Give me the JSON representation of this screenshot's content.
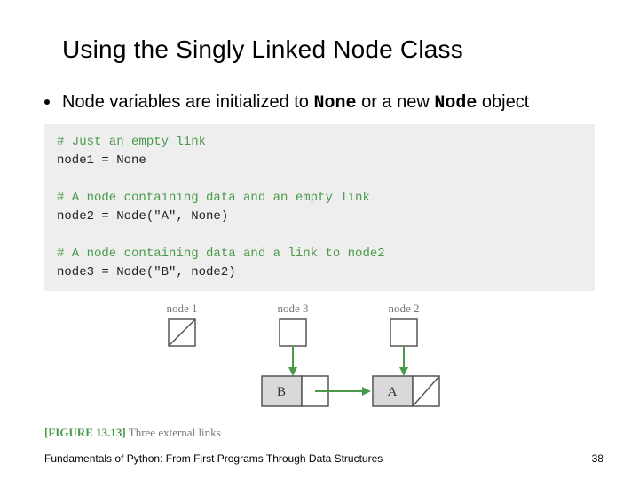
{
  "title": "Using the Singly Linked Node Class",
  "bullet": {
    "pre": "Node variables are initialized to ",
    "code1": "None",
    "mid": " or a new ",
    "code2": "Node",
    "post": " object"
  },
  "code": {
    "c1": "# Just an empty link",
    "s1": "node1 = None",
    "c2": "# A node containing data and an empty link",
    "s2": "node2 = Node(\"A\", None)",
    "c3": "# A node containing data and a link to node2",
    "s3": "node3 = Node(\"B\", node2)"
  },
  "diagram": {
    "labels": {
      "n1": "node 1",
      "n3": "node 3",
      "n2": "node 2"
    },
    "data": {
      "b": "B",
      "a": "A"
    }
  },
  "caption": {
    "lb": "[",
    "tag": "FIGURE 13.13",
    "rb": "]",
    "text": " Three external links"
  },
  "footer": "Fundamentals of Python: From First Programs Through Data Structures",
  "page": "38"
}
